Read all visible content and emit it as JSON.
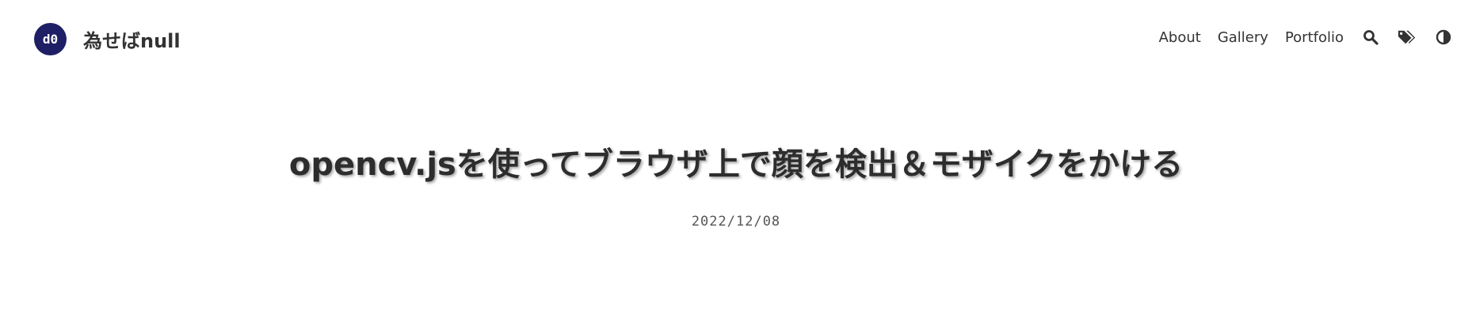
{
  "site": {
    "logo_text": "d0",
    "title": "為せばnull"
  },
  "nav": {
    "links": [
      {
        "label": "About"
      },
      {
        "label": "Gallery"
      },
      {
        "label": "Portfolio"
      }
    ],
    "icons": [
      "search-icon",
      "tags-icon",
      "theme-toggle-icon"
    ]
  },
  "post": {
    "title": "opencv.jsを使ってブラウザ上で顔を検出＆モザイクをかける",
    "date": "2022/12/08"
  },
  "colors": {
    "logo_bg": "#1f1f66",
    "text": "#333333"
  }
}
